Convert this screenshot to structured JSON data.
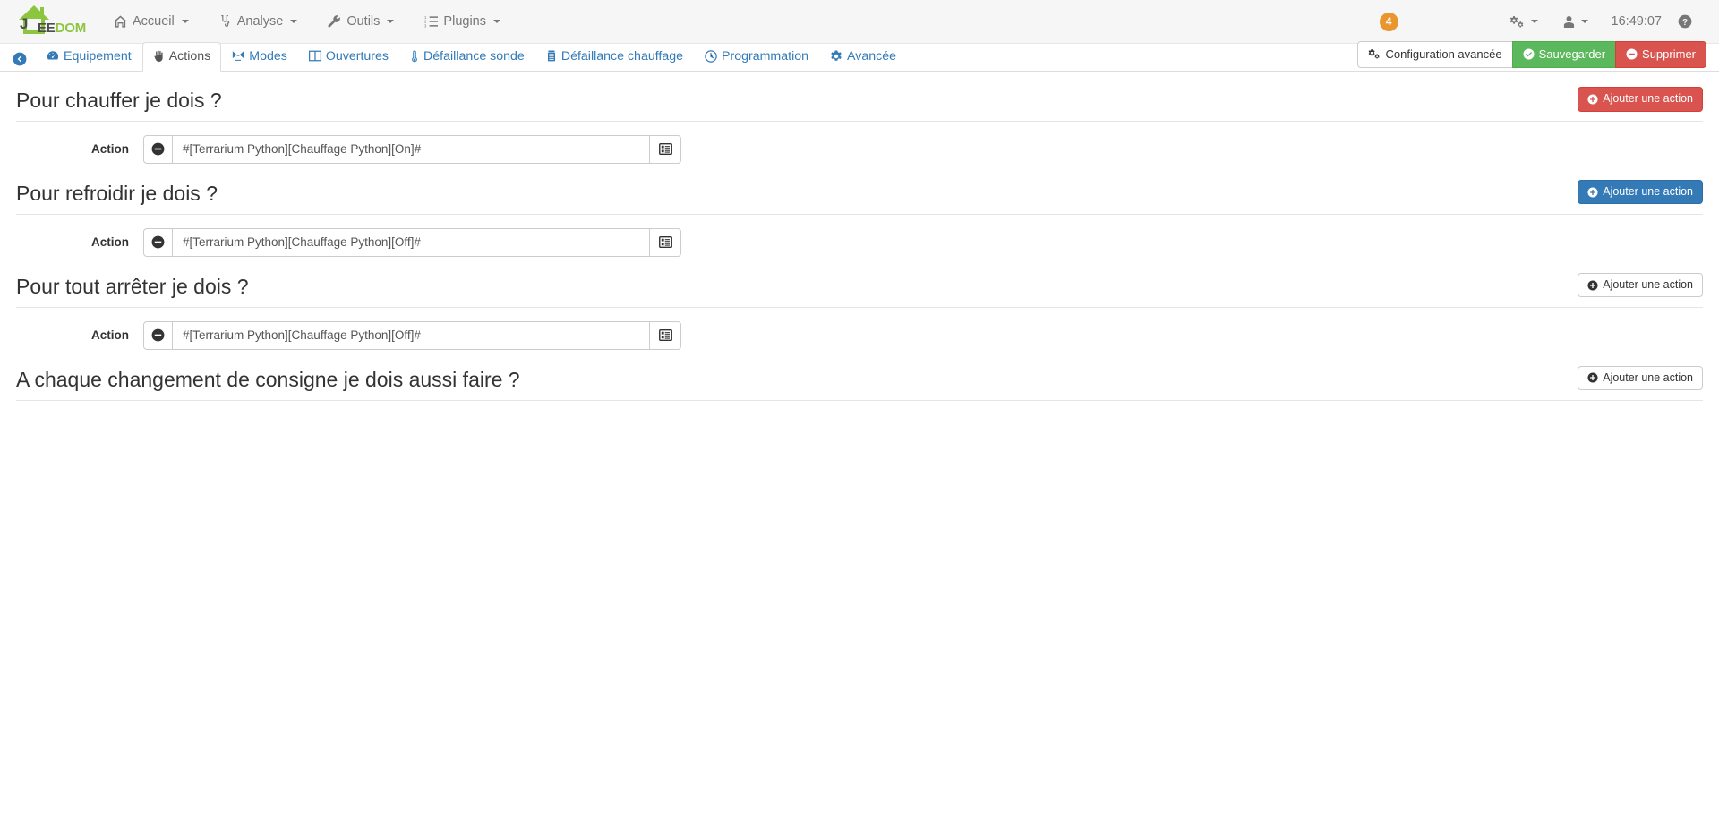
{
  "navbar": {
    "brand": {
      "j": "J",
      "ee": "EE",
      "dom": "DOM"
    },
    "items": [
      {
        "label": "Accueil",
        "icon": "home-icon",
        "caret": true
      },
      {
        "label": "Analyse",
        "icon": "stethoscope-icon",
        "caret": true
      },
      {
        "label": "Outils",
        "icon": "wrench-icon",
        "caret": true
      },
      {
        "label": "Plugins",
        "icon": "list-ol-icon",
        "caret": true
      }
    ],
    "badge_count": "4",
    "settings": {
      "icon": "gears-icon",
      "caret": true
    },
    "user": {
      "icon": "user-icon",
      "caret": true
    },
    "clock": "16:49:07",
    "help": {
      "icon": "question-circle-icon"
    }
  },
  "tabbar": {
    "back": {
      "icon": "arrow-circle-left-icon"
    },
    "tabs": [
      {
        "label": "Equipement",
        "icon": "tachometer-icon",
        "active": false
      },
      {
        "label": "Actions",
        "icon": "hand-paper-icon",
        "active": true
      },
      {
        "label": "Modes",
        "icon": "compress-icon",
        "active": false
      },
      {
        "label": "Ouvertures",
        "icon": "columns-icon",
        "active": false
      },
      {
        "label": "Défaillance sonde",
        "icon": "thermometer-icon",
        "active": false
      },
      {
        "label": "Défaillance chauffage",
        "icon": "fire-icon",
        "active": false
      },
      {
        "label": "Programmation",
        "icon": "clock-icon",
        "active": false
      },
      {
        "label": "Avancée",
        "icon": "cog-icon",
        "active": false
      }
    ],
    "buttons": [
      {
        "label": "Configuration avancée",
        "icon": "gears-icon",
        "style": "btn-default"
      },
      {
        "label": "Sauvegarder",
        "icon": "check-circle-icon",
        "style": "btn-success"
      },
      {
        "label": "Supprimer",
        "icon": "minus-circle-icon",
        "style": "btn-danger"
      }
    ]
  },
  "sections": [
    {
      "title": "Pour chauffer je dois ?",
      "add_button": {
        "label": "Ajouter une action",
        "icon": "plus-circle-icon",
        "style": "btn-danger"
      },
      "rows": [
        {
          "label": "Action",
          "remove_icon": "minus-circle-icon",
          "value": "#[Terrarium Python][Chauffage Python][On]#",
          "placeholder": "",
          "helper_icon": "list-alt-icon"
        }
      ]
    },
    {
      "title": "Pour refroidir je dois ?",
      "add_button": {
        "label": "Ajouter une action",
        "icon": "plus-circle-icon",
        "style": "btn-primary"
      },
      "rows": [
        {
          "label": "Action",
          "remove_icon": "minus-circle-icon",
          "value": "#[Terrarium Python][Chauffage Python][Off]#",
          "placeholder": "",
          "helper_icon": "list-alt-icon"
        }
      ]
    },
    {
      "title": "Pour tout arrêter je dois ?",
      "add_button": {
        "label": "Ajouter une action",
        "icon": "plus-circle-icon",
        "style": "btn-default"
      },
      "rows": [
        {
          "label": "Action",
          "remove_icon": "minus-circle-icon",
          "value": "#[Terrarium Python][Chauffage Python][Off]#",
          "placeholder": "",
          "helper_icon": "list-alt-icon"
        }
      ]
    },
    {
      "title": "A chaque changement de consigne je dois aussi faire ?",
      "add_button": {
        "label": "Ajouter une action",
        "icon": "plus-circle-icon",
        "style": "btn-default"
      },
      "rows": []
    }
  ],
  "colors": {
    "brand_green": "#8cc63e",
    "link_blue": "#337ab7",
    "badge_orange": "#e9962f",
    "success_green": "#5cb85c",
    "danger_red": "#d9534f",
    "navbar_bg": "#f6f6f6"
  }
}
